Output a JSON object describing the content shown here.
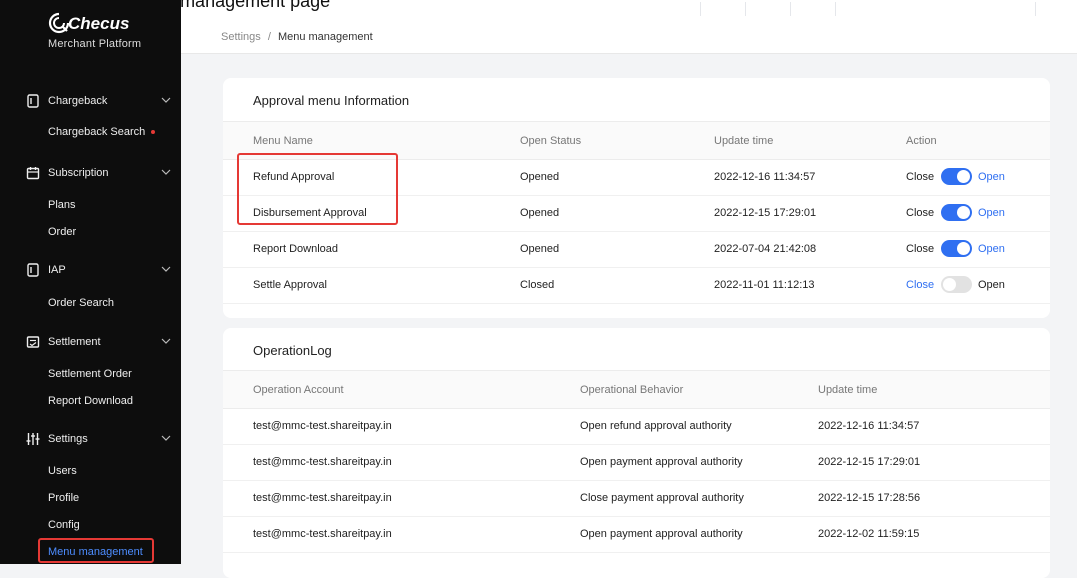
{
  "colors": {
    "accent": "#2f6ff1",
    "highlight": "#e53935",
    "sidebar_bg": "#0d0d0d",
    "badge": "#e53935"
  },
  "brand": {
    "name": "Checus",
    "subtitle": "Merchant  Platform",
    "logo_icon": "checus-logo-icon"
  },
  "top_strip": {
    "partial_text": "Settings  Menu management page"
  },
  "sidebar": {
    "groups": [
      {
        "label": "Chargeback",
        "icon": "document-icon",
        "items": [
          {
            "label": "Chargeback Search",
            "badge": "dot"
          }
        ]
      },
      {
        "label": "Subscription",
        "icon": "calendar-icon",
        "items": [
          {
            "label": "Plans"
          },
          {
            "label": "Order"
          }
        ]
      },
      {
        "label": "IAP",
        "icon": "document-icon",
        "items": [
          {
            "label": "Order Search"
          }
        ]
      },
      {
        "label": "Settlement",
        "icon": "receipt-icon",
        "items": [
          {
            "label": "Settlement Order"
          },
          {
            "label": "Report Download"
          }
        ]
      },
      {
        "label": "Settings",
        "icon": "sliders-icon",
        "items": [
          {
            "label": "Users"
          },
          {
            "label": "Profile"
          },
          {
            "label": "Config"
          },
          {
            "label": "Menu management",
            "active": true
          }
        ]
      }
    ]
  },
  "breadcrumb": {
    "parent": "Settings",
    "separator": "/",
    "current": "Menu management"
  },
  "approval": {
    "title": "Approval menu Information",
    "columns": [
      "Menu Name",
      "Open Status",
      "Update time",
      "Action"
    ],
    "rows": [
      {
        "name": "Refund Approval",
        "status": "Opened",
        "time": "2022-12-16 11:34:57",
        "close": "Close",
        "open": "Open",
        "enabled": true
      },
      {
        "name": "Disbursement Approval",
        "status": "Opened",
        "time": "2022-12-15 17:29:01",
        "close": "Close",
        "open": "Open",
        "enabled": true
      },
      {
        "name": "Report Download",
        "status": "Opened",
        "time": "2022-07-04 21:42:08",
        "close": "Close",
        "open": "Open",
        "enabled": true
      },
      {
        "name": "Settle Approval",
        "status": "Closed",
        "time": "2022-11-01 11:12:13",
        "close": "Close",
        "open": "Open",
        "enabled": false
      }
    ]
  },
  "oplog": {
    "title": "OperationLog",
    "columns": [
      "Operation Account",
      "Operational Behavior",
      "Update time"
    ],
    "rows": [
      {
        "account": "test@mmc-test.shareitpay.in",
        "behavior": "Open refund approval authority",
        "time": "2022-12-16 11:34:57"
      },
      {
        "account": "test@mmc-test.shareitpay.in",
        "behavior": "Open payment approval authority",
        "time": "2022-12-15 17:29:01"
      },
      {
        "account": "test@mmc-test.shareitpay.in",
        "behavior": "Close payment approval authority",
        "time": "2022-12-15 17:28:56"
      },
      {
        "account": "test@mmc-test.shareitpay.in",
        "behavior": "Open payment approval authority",
        "time": "2022-12-02 11:59:15"
      }
    ]
  }
}
